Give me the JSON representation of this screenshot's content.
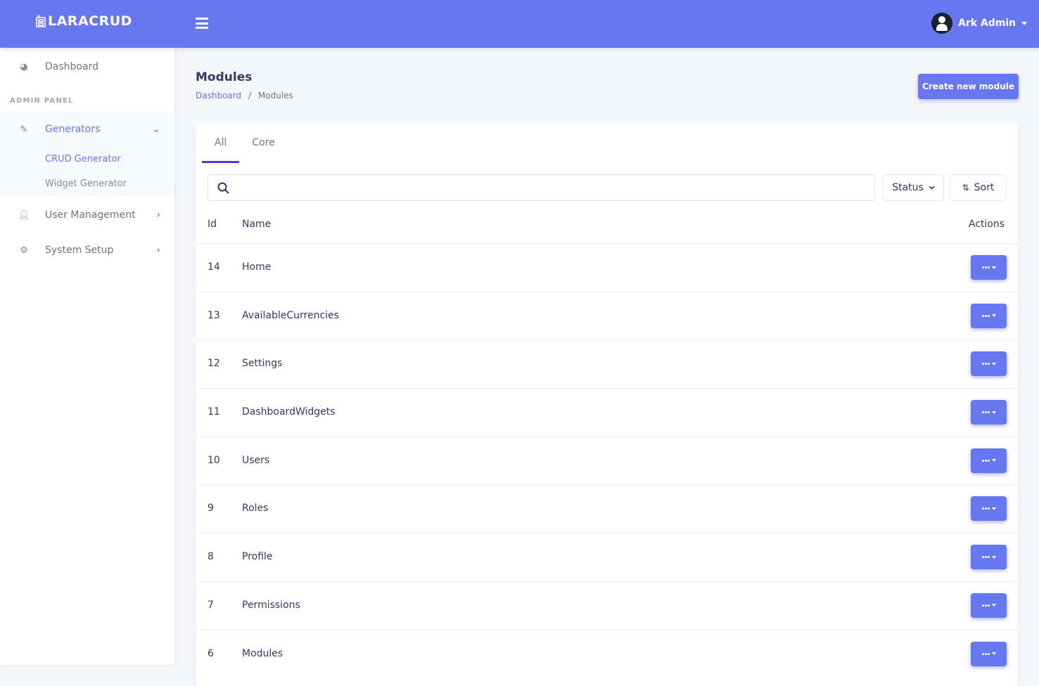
{
  "app": {
    "logo": "LARACRUD",
    "user": "Ark Admin"
  },
  "sidebar": {
    "dashboard": "Dashboard",
    "section": "ADMIN PANEL",
    "generators": "Generators",
    "crud_generator": "CRUD Generator",
    "widget_generator": "Widget Generator",
    "user_management": "User Management",
    "system_setup": "System Setup"
  },
  "page": {
    "title": "Modules",
    "breadcrumb": [
      "Dashboard",
      "Modules"
    ],
    "create_label": "Create new module"
  },
  "tabs": [
    "All",
    "Core"
  ],
  "search": {
    "placeholder": ""
  },
  "filters": {
    "status": "Status",
    "sort": "Sort"
  },
  "table": {
    "headers": [
      "Id",
      "Name",
      "Actions"
    ],
    "rows": [
      {
        "id": "14",
        "name": "Home"
      },
      {
        "id": "13",
        "name": "AvailableCurrencies"
      },
      {
        "id": "12",
        "name": "Settings"
      },
      {
        "id": "11",
        "name": "DashboardWidgets"
      },
      {
        "id": "10",
        "name": "Users"
      },
      {
        "id": "9",
        "name": "Roles"
      },
      {
        "id": "8",
        "name": "Profile"
      },
      {
        "id": "7",
        "name": "Permissions"
      },
      {
        "id": "6",
        "name": "Modules"
      }
    ]
  },
  "colors": {
    "primary": "#6777ef"
  }
}
